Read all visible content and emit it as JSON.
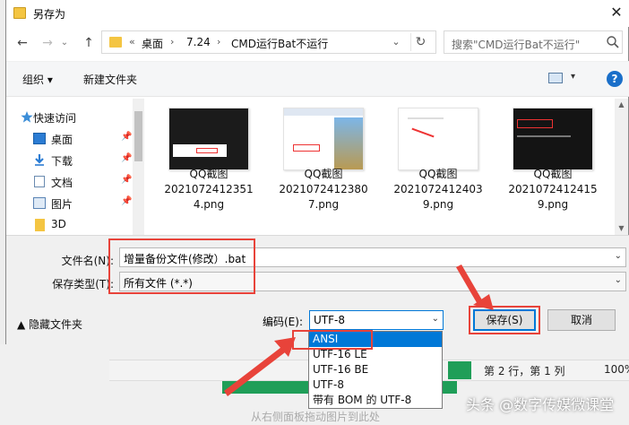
{
  "dialog": {
    "title": "另存为",
    "close_glyph": "✕"
  },
  "nav": {
    "back": "←",
    "forward": "→",
    "dropdown": "⌄",
    "up": "↑"
  },
  "address": {
    "prefix": "«",
    "segments": [
      "桌面",
      "7.24",
      "CMD运行Bat不运行"
    ],
    "separator": "›",
    "dropdown": "⌄",
    "refresh": "↻"
  },
  "search": {
    "placeholder": "搜索\"CMD运行Bat不运行\""
  },
  "toolbar": {
    "organize": "组织 ▾",
    "new_folder": "新建文件夹",
    "view_dropdown": "▾",
    "help": "?"
  },
  "sidebar": {
    "items": [
      {
        "label": "快速访问",
        "icon": "star-icon",
        "pinned": false
      },
      {
        "label": "桌面",
        "icon": "desktop-icon",
        "pinned": true
      },
      {
        "label": "下载",
        "icon": "download-icon",
        "pinned": true
      },
      {
        "label": "文档",
        "icon": "document-icon",
        "pinned": true
      },
      {
        "label": "图片",
        "icon": "pictures-icon",
        "pinned": true
      },
      {
        "label": "3D",
        "icon": "folder-icon",
        "pinned": false
      }
    ],
    "pin_glyph": "📌"
  },
  "files": [
    {
      "line1": "QQ截图",
      "line2": "2021072412351",
      "line3": "4.png",
      "style": "dark"
    },
    {
      "line1": "QQ截图",
      "line2": "2021072412380",
      "line3": "7.png",
      "style": "light"
    },
    {
      "line1": "QQ截图",
      "line2": "2021072412403",
      "line3": "9.png",
      "style": "white"
    },
    {
      "line1": "QQ截图",
      "line2": "2021072412415",
      "line3": "9.png",
      "style": "dark"
    }
  ],
  "form": {
    "filename_label": "文件名(N):",
    "filename_value": "增量备份文件(修改）.bat",
    "type_label": "保存类型(T):",
    "type_value": "所有文件 (*.*)",
    "hide_folders": "▲ 隐藏文件夹",
    "encoding_label": "编码(E):",
    "encoding_value": "UTF-8",
    "save_button": "保存(S)",
    "cancel_button": "取消"
  },
  "encoding_options": [
    "ANSI",
    "UTF-16 LE",
    "UTF-16 BE",
    "UTF-8",
    "带有 BOM 的 UTF-8"
  ],
  "encoding_highlighted": "ANSI",
  "background": {
    "status_pos": "第 2 行，第 1 列",
    "zoom": "100%",
    "placeholder": "从右侧面板拖动图片到此处"
  },
  "watermark": {
    "text": "头条 @数字传媒微课堂"
  },
  "colors": {
    "accent": "#0078d7",
    "annotation_red": "#e8433a",
    "folder_yellow": "#f4c542"
  }
}
